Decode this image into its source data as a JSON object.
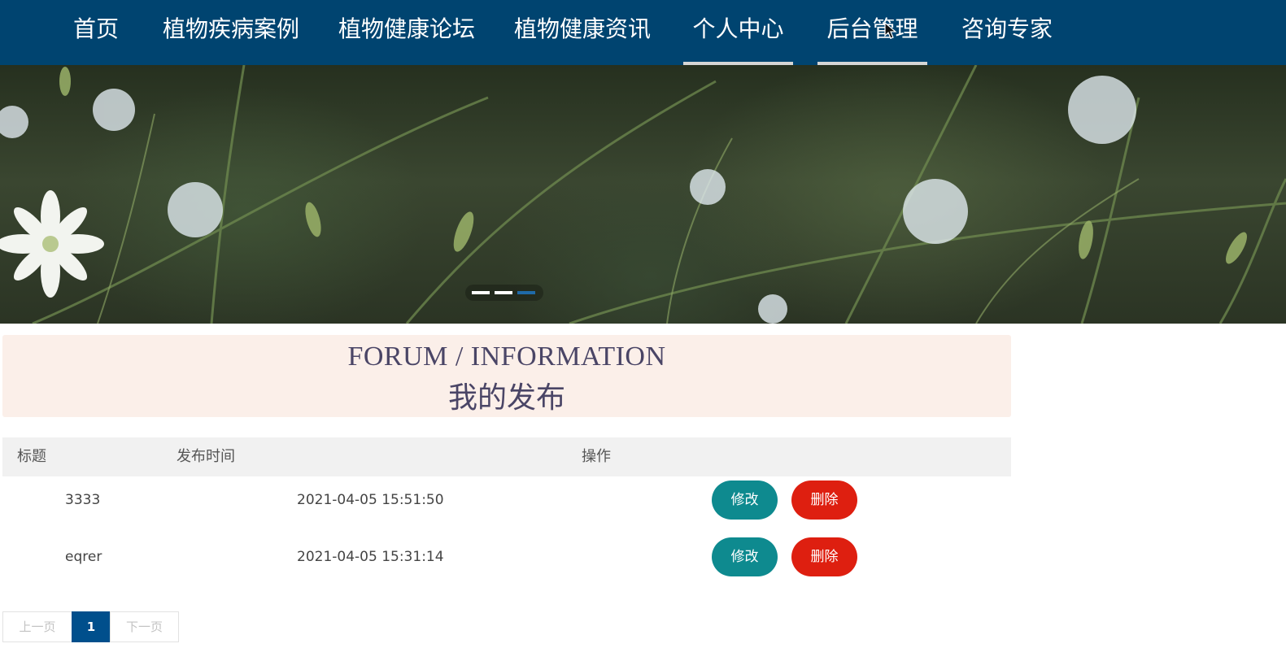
{
  "nav": {
    "items": [
      {
        "label": "首页"
      },
      {
        "label": "植物疾病案例"
      },
      {
        "label": "植物健康论坛"
      },
      {
        "label": "植物健康资讯"
      },
      {
        "label": "个人中心"
      },
      {
        "label": "后台管理"
      },
      {
        "label": "咨询专家"
      }
    ],
    "active": [
      "个人中心",
      "后台管理"
    ],
    "background": "#004470"
  },
  "carousel": {
    "slide_count": 3,
    "active_index": 3,
    "indicator_active_color": "#1f6aa8"
  },
  "section": {
    "title_en": "FORUM / INFORMATION",
    "title_cn": "我的发布",
    "background": "#fbefe9"
  },
  "table": {
    "columns": [
      "标题",
      "发布时间",
      "操作"
    ],
    "rows": [
      {
        "title": "3333",
        "time": "2021-04-05 15:51:50",
        "edit_label": "修改",
        "delete_label": "删除"
      },
      {
        "title": "eqrer",
        "time": "2021-04-05 15:31:14",
        "edit_label": "修改",
        "delete_label": "删除"
      }
    ],
    "edit_color": "#0e8a8f",
    "delete_color": "#de1f10"
  },
  "pager": {
    "prev_label": "上一页",
    "current_page": "1",
    "next_label": "下一页"
  }
}
